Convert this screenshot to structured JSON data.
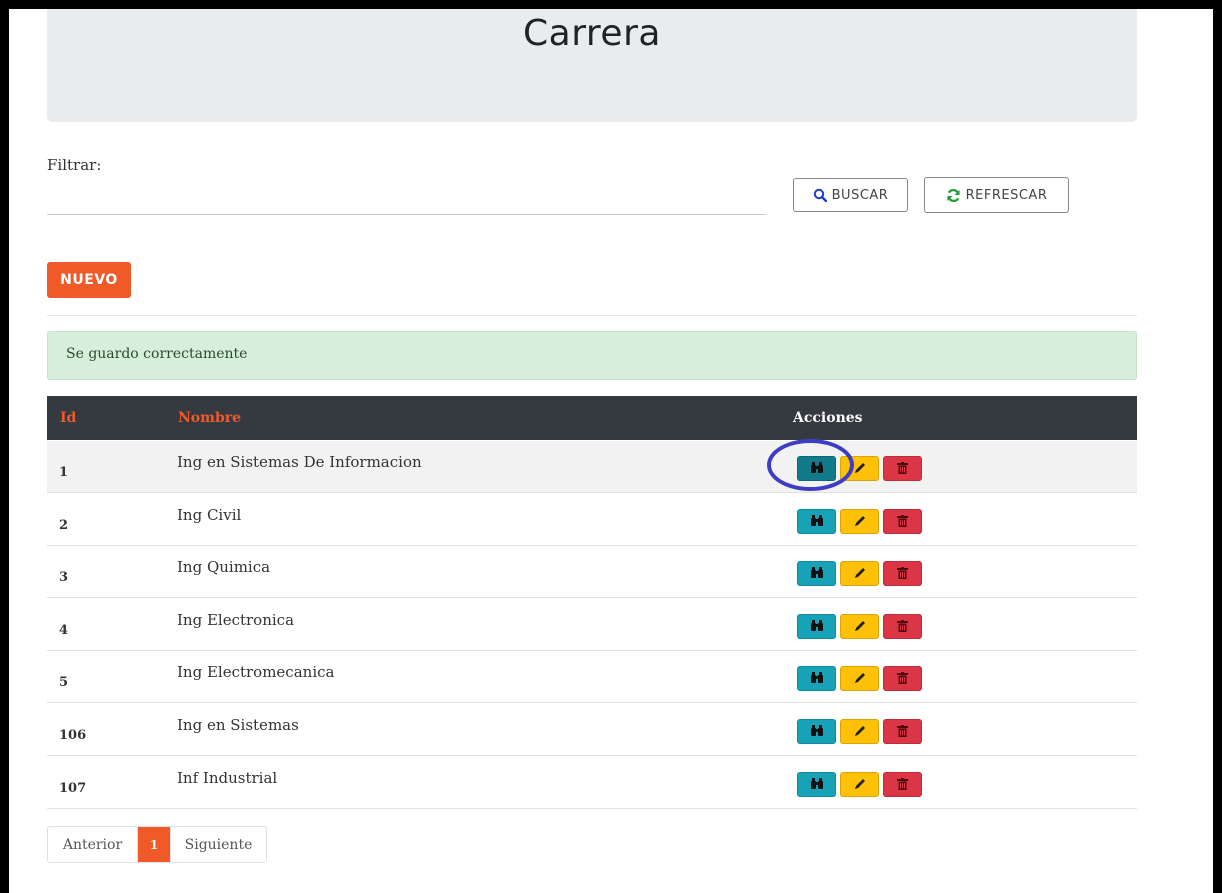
{
  "page_title": "Carrera",
  "filter": {
    "label": "Filtrar:",
    "value": "",
    "placeholder": ""
  },
  "buttons": {
    "search": "BUSCAR",
    "refresh": "REFRESCAR",
    "new": "NUEVO"
  },
  "alert": {
    "message": "Se guardo correctamente"
  },
  "table": {
    "headers": {
      "id": "Id",
      "name": "Nombre",
      "actions": "Acciones"
    },
    "rows": [
      {
        "id": "1",
        "name": "Ing en Sistemas De Informacion"
      },
      {
        "id": "2",
        "name": "Ing Civil"
      },
      {
        "id": "3",
        "name": "Ing Quimica"
      },
      {
        "id": "4",
        "name": "Ing Electronica"
      },
      {
        "id": "5",
        "name": "Ing Electromecanica"
      },
      {
        "id": "106",
        "name": "Ing en Sistemas"
      },
      {
        "id": "107",
        "name": "Inf Industrial"
      }
    ],
    "row_actions": [
      "binoculars-icon",
      "pencil-icon",
      "trash-icon"
    ]
  },
  "pagination": {
    "prev": "Anterior",
    "current": "1",
    "next": "Siguiente"
  },
  "colors": {
    "accent": "#f05a28",
    "view": "#17a2b8",
    "edit": "#ffc107",
    "delete": "#dc3545",
    "header_bg": "#343a40",
    "alert_bg": "#d6efdb"
  }
}
